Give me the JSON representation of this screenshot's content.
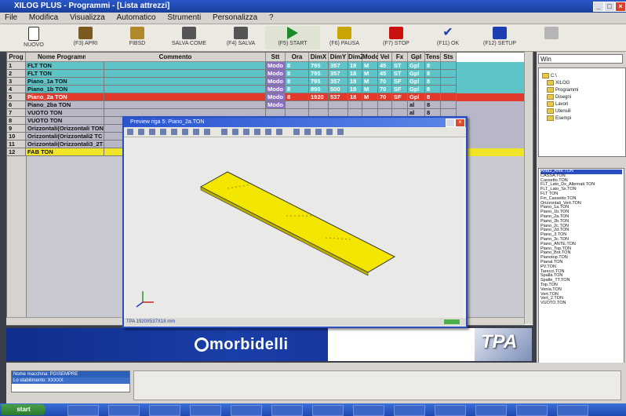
{
  "window": {
    "title": "XILOG PLUS - Programmi - [Lista attrezzi]"
  },
  "menu": {
    "items": [
      "File",
      "Modifica",
      "Visualizza",
      "Automatico",
      "Strumenti",
      "Personalizza",
      "?"
    ]
  },
  "toolbar": {
    "buttons": [
      {
        "label": "NUOVO",
        "icon": "new-document-icon",
        "color": "#333333"
      },
      {
        "label": "(F3) APRI",
        "icon": "open-icon",
        "color": "#7a5a20"
      },
      {
        "label": "FIBSD",
        "icon": "folder-icon",
        "color": "#b0882a"
      },
      {
        "label": "SALVA COME",
        "icon": "save-as-icon",
        "color": "#555555"
      },
      {
        "label": "(F4) SALVA",
        "icon": "save-icon",
        "color": "#555555"
      },
      {
        "label": "(F5) START",
        "icon": "play-icon",
        "color": "#1b8a2a"
      },
      {
        "label": "(F6) PAUSA",
        "icon": "pause-icon",
        "color": "#c9a500"
      },
      {
        "label": "(F7) STOP",
        "icon": "stop-icon",
        "color": "#cc1111"
      },
      {
        "label": "(F11) OK",
        "icon": "check-icon",
        "color": "#1b3fb0"
      },
      {
        "label": "(F12) SETUP",
        "icon": "setup-icon",
        "color": "#1b3fb0"
      },
      {
        "label": "",
        "icon": "disabled-icon",
        "color": "#b5b5b5"
      }
    ]
  },
  "table": {
    "columns": [
      "Prog",
      "Nome Programma",
      "Commento",
      "Stt",
      "Ora",
      "DimX",
      "DimY",
      "DimZ",
      "Modo",
      "Vel",
      "Fx",
      "Gpl",
      "Tens",
      "Sts"
    ],
    "rows": [
      {
        "prog": "1",
        "name": "FLT TON",
        "comment": "",
        "stt": "Modo",
        "ora": "8",
        "dimx": "795",
        "dimy": "357",
        "dimz": "18",
        "modo": "M",
        "vel": "45",
        "fx": "ST",
        "gpl": "Gpl",
        "tens": "8",
        "sts": ""
      },
      {
        "prog": "2",
        "name": "FLT TON",
        "comment": "",
        "stt": "Modo",
        "ora": "8",
        "dimx": "795",
        "dimy": "357",
        "dimz": "18",
        "modo": "M",
        "vel": "45",
        "fx": "ST",
        "gpl": "Gpl",
        "tens": "8",
        "sts": ""
      },
      {
        "prog": "3",
        "name": "Piano_1a TON",
        "comment": "",
        "stt": "Modo",
        "ora": "8",
        "dimx": "795",
        "dimy": "357",
        "dimz": "18",
        "modo": "M",
        "vel": "70",
        "fx": "SF",
        "gpl": "Gpl",
        "tens": "8",
        "sts": ""
      },
      {
        "prog": "4",
        "name": "Piano_1b TON",
        "comment": "",
        "stt": "Modo",
        "ora": "8",
        "dimx": "890",
        "dimy": "500",
        "dimz": "18",
        "modo": "M",
        "vel": "70",
        "fx": "SF",
        "gpl": "Gpl",
        "tens": "8",
        "sts": ""
      },
      {
        "prog": "5",
        "name": "Piano_2a TON",
        "comment": "",
        "stt": "Modo",
        "ora": "8",
        "dimx": "1920",
        "dimy": "537",
        "dimz": "18",
        "modo": "M",
        "vel": "70",
        "fx": "SF",
        "gpl": "Gpl",
        "tens": "8",
        "sts": ""
      },
      {
        "prog": "6",
        "name": "Piano_2ba TON",
        "comment": "",
        "stt": "Modo",
        "ora": "",
        "dimx": "",
        "dimy": "",
        "dimz": "",
        "modo": "",
        "vel": "",
        "fx": "",
        "gpl": "al",
        "tens": "8",
        "sts": ""
      },
      {
        "prog": "7",
        "name": "VUOTO TON",
        "comment": "",
        "stt": "",
        "ora": "",
        "dimx": "",
        "dimy": "",
        "dimz": "",
        "modo": "",
        "vel": "",
        "fx": "",
        "gpl": "al",
        "tens": "8",
        "sts": ""
      },
      {
        "prog": "8",
        "name": "VUOTO TON",
        "comment": "",
        "stt": "",
        "ora": "",
        "dimx": "",
        "dimy": "",
        "dimz": "",
        "modo": "",
        "vel": "",
        "fx": "",
        "gpl": "al",
        "tens": "8",
        "sts": ""
      },
      {
        "prog": "9",
        "name": "Orizzontali(Orizzontali TON",
        "comment": "",
        "stt": "",
        "ora": "",
        "dimx": "",
        "dimy": "",
        "dimz": "",
        "modo": "",
        "vel": "",
        "fx": "",
        "gpl": "al",
        "tens": "8",
        "sts": ""
      },
      {
        "prog": "10",
        "name": "Orizzontali(Orizzontali2 TC",
        "comment": "",
        "stt": "",
        "ora": "",
        "dimx": "",
        "dimy": "",
        "dimz": "",
        "modo": "",
        "vel": "",
        "fx": "",
        "gpl": "al",
        "tens": "8",
        "sts": ""
      },
      {
        "prog": "11",
        "name": "Orizzontali(Orizzontali3_2T",
        "comment": "",
        "stt": "",
        "ora": "",
        "dimx": "",
        "dimy": "",
        "dimz": "",
        "modo": "",
        "vel": "",
        "fx": "",
        "gpl": "al",
        "tens": "8",
        "sts": ""
      },
      {
        "prog": "12",
        "name": "FAB TON",
        "comment": "",
        "stt": "",
        "ora": "",
        "dimx": "",
        "dimy": "",
        "dimz": "",
        "modo": "",
        "vel": "",
        "fx": "",
        "gpl": "al",
        "tens": "8",
        "sts": ""
      }
    ]
  },
  "dialog": {
    "title": "Preview riga 5: Piano_2a.TON",
    "status": "TPA  1920X537X18 mm",
    "icons": [
      "open",
      "save",
      "print",
      "zoom-in",
      "zoom-out",
      "zoom-window",
      "zoom-all",
      "zoom-prev",
      "rotate",
      "pan",
      "view-top",
      "view-front",
      "view-side",
      "view-iso",
      "view-3d",
      "shade",
      "wire",
      "hidden",
      "info"
    ]
  },
  "banner": {
    "brand": "morbidelli",
    "logo": "TPA"
  },
  "rightpanel": {
    "search": "Win",
    "tree": [
      "C:\\",
      "XILOG",
      "Programmi",
      "Disegni",
      "Lavori",
      "Utensili",
      "Esempi"
    ],
    "files": [
      "Anta3_Ante.TON",
      "CASSA.TON",
      "Cassetto.TON",
      "FLT_Lato_Dx_Alternati.TON",
      "FLT_Lato_Sx.TON",
      "FLT TON",
      "Fin_Cassetto.TON",
      "Orizzontali_Vert.TON",
      "Piano_1a.TON",
      "Piano_1b.TON",
      "Piano_2a.TON",
      "Piano_2b.TON",
      "Piano_2c.TON",
      "Piano_2d.TON",
      "Piano_3.TON",
      "Piano_3c.TON",
      "Piano_ANTE.TON",
      "Piano_Top.TON",
      "Piano_Bot.TON",
      "Pianotop.TON",
      "Pianal.TON",
      "PV.TON",
      "Tarecci.TON",
      "Spalla.TON",
      "Spalle_TT.TON",
      "Top.TON",
      "Venia.TON",
      "Vert.TON",
      "Vert_2.TON",
      "VUOTO.TON"
    ]
  },
  "bottom": {
    "lines": [
      "Nome macchina: PG\\SEMPRE",
      "Lo stabilimento: XXXXX"
    ]
  },
  "taskbar": {
    "start": "start",
    "items": [
      "",
      "",
      "",
      "",
      "",
      "",
      "",
      "",
      "",
      "",
      "",
      "",
      ""
    ]
  }
}
